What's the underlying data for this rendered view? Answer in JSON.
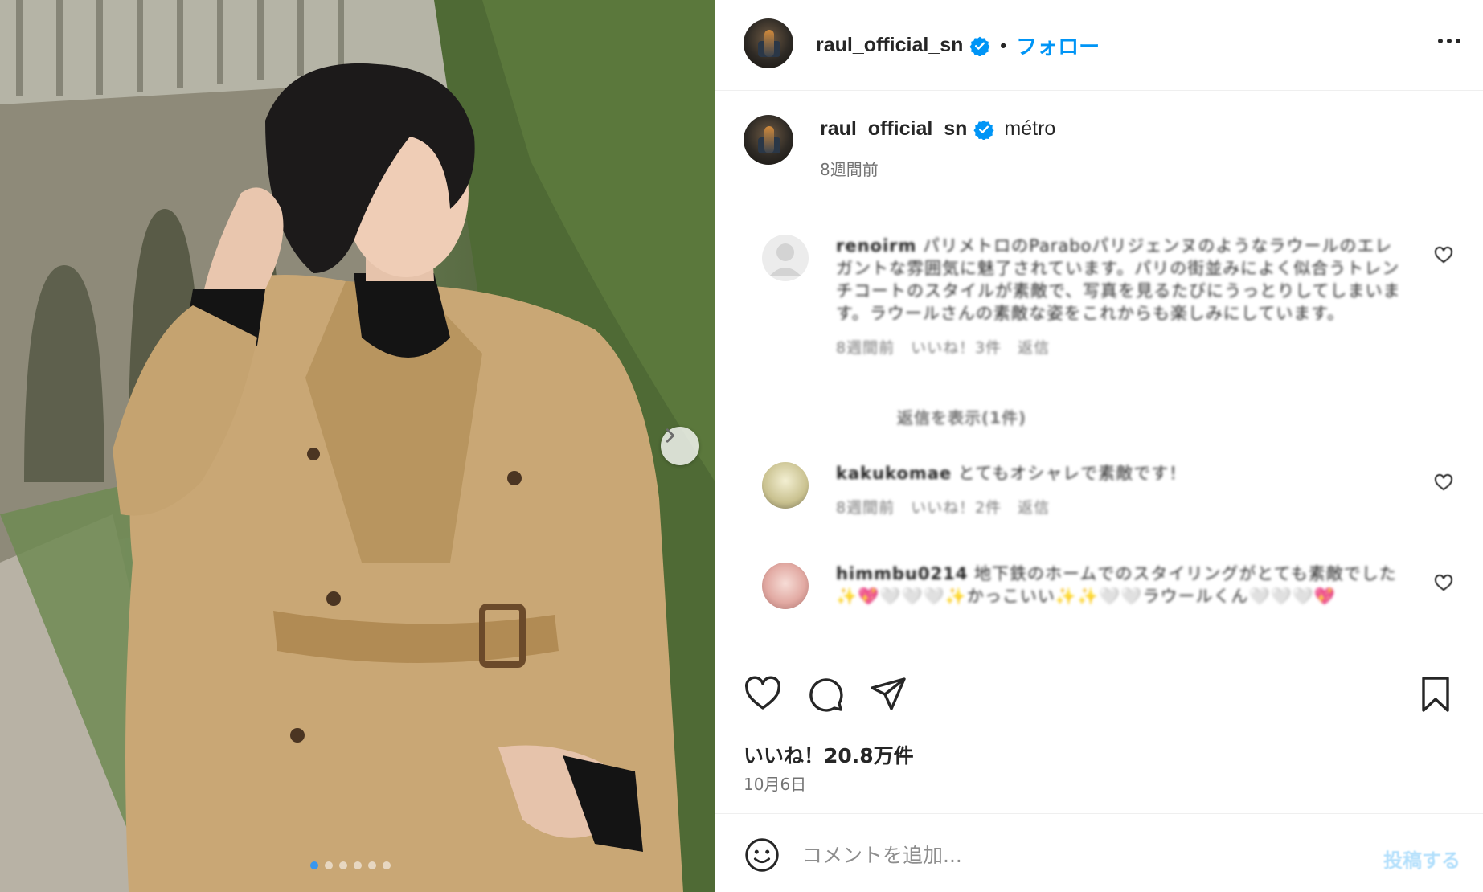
{
  "post": {
    "username": "raul_official_sn",
    "follow_label": "フォロー",
    "bullet": "•",
    "caption": "métro",
    "caption_time": "8週間前",
    "likes": "いいね！20.8万件",
    "date": "10月6日",
    "media_dots": 6,
    "active_dot": 0
  },
  "comments": [
    {
      "user": "renoirm",
      "text": "パリメトロのParaboパリジェンヌのようなラウールのエレガントな雰囲気に魅了されています。パリの街並みによく似合うトレンチコートのスタイルが素敵で、写真を見るたびにうっとりしてしまいます。ラウールさんの素敵な姿をこれからも楽しみにしています。",
      "meta": "8週間前　いいね！3件　返信",
      "avatar_color": "#ececec"
    },
    {
      "user": "kakukomae",
      "text": "とてもオシャレで素敵です！",
      "meta": "8週間前　いいね！2件　返信",
      "avatar_color": "#d8d3a8"
    },
    {
      "user": "himmbu0214",
      "text": "地下鉄のホームでのスタイリングがとても素敵でした✨💖🤍🤍🤍✨かっこいい✨✨🤍🤍ラウールくん🤍🤍🤍💖",
      "meta": "",
      "avatar_color": "#e8b9b3"
    }
  ],
  "view_replies": "返信を表示(1件)",
  "composer": {
    "placeholder": "コメントを追加...",
    "post_label": "投稿する"
  },
  "icons": {
    "verified": "verified-badge-icon",
    "more": "more-options-icon",
    "next": "chevron-right-icon",
    "like": "heart-icon",
    "comment": "comment-bubble-icon",
    "share": "paper-plane-icon",
    "save": "bookmark-icon",
    "emoji": "smiley-face-icon"
  },
  "colors": {
    "accent": "#0095f6",
    "verified": "#0095f6",
    "muted": "#737373",
    "text": "#262626"
  }
}
